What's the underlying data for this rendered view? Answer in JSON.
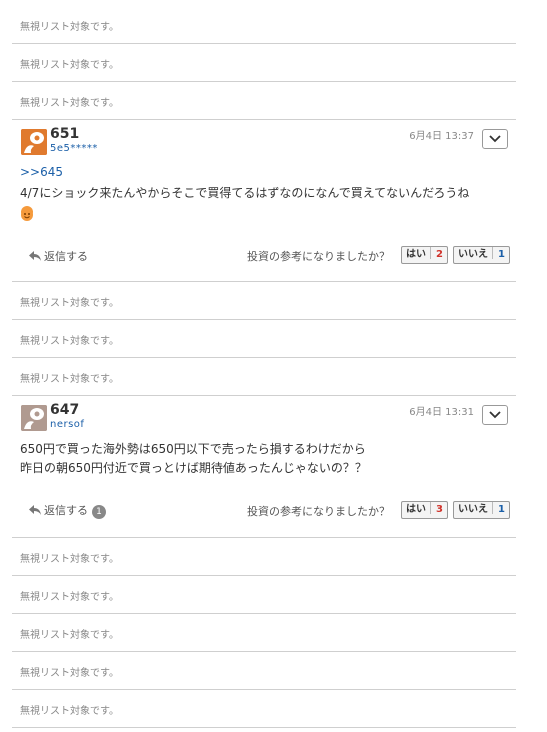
{
  "ignored_text": "無視リスト対象です。",
  "posts": [
    {
      "number": "651",
      "user": "5e5*****",
      "date": "6月4日 13:37",
      "anchor": ">>645",
      "lines": [
        "4/7にショック来たんやからそこで買得てるはずなのになんで買えてないんだろうね"
      ],
      "reply_label": "返信する",
      "reply_count": "",
      "question": "投資の参考になりましたか？",
      "yes_label": "はい",
      "yes_count": "2",
      "no_label": "いいえ",
      "no_count": "1",
      "avatar_color": "#e07a2e"
    },
    {
      "number": "647",
      "user": "nersof",
      "date": "6月4日 13:31",
      "anchor": "",
      "lines": [
        "650円で買った海外勢は650円以下で売ったら損するわけだから",
        "昨日の朝650円付近で買っとけば期待値あったんじゃないの？？"
      ],
      "reply_label": "返信する",
      "reply_count": "1",
      "question": "投資の参考になりましたか？",
      "yes_label": "はい",
      "yes_count": "3",
      "no_label": "いいえ",
      "no_count": "1",
      "avatar_color": "#b09a90"
    }
  ]
}
